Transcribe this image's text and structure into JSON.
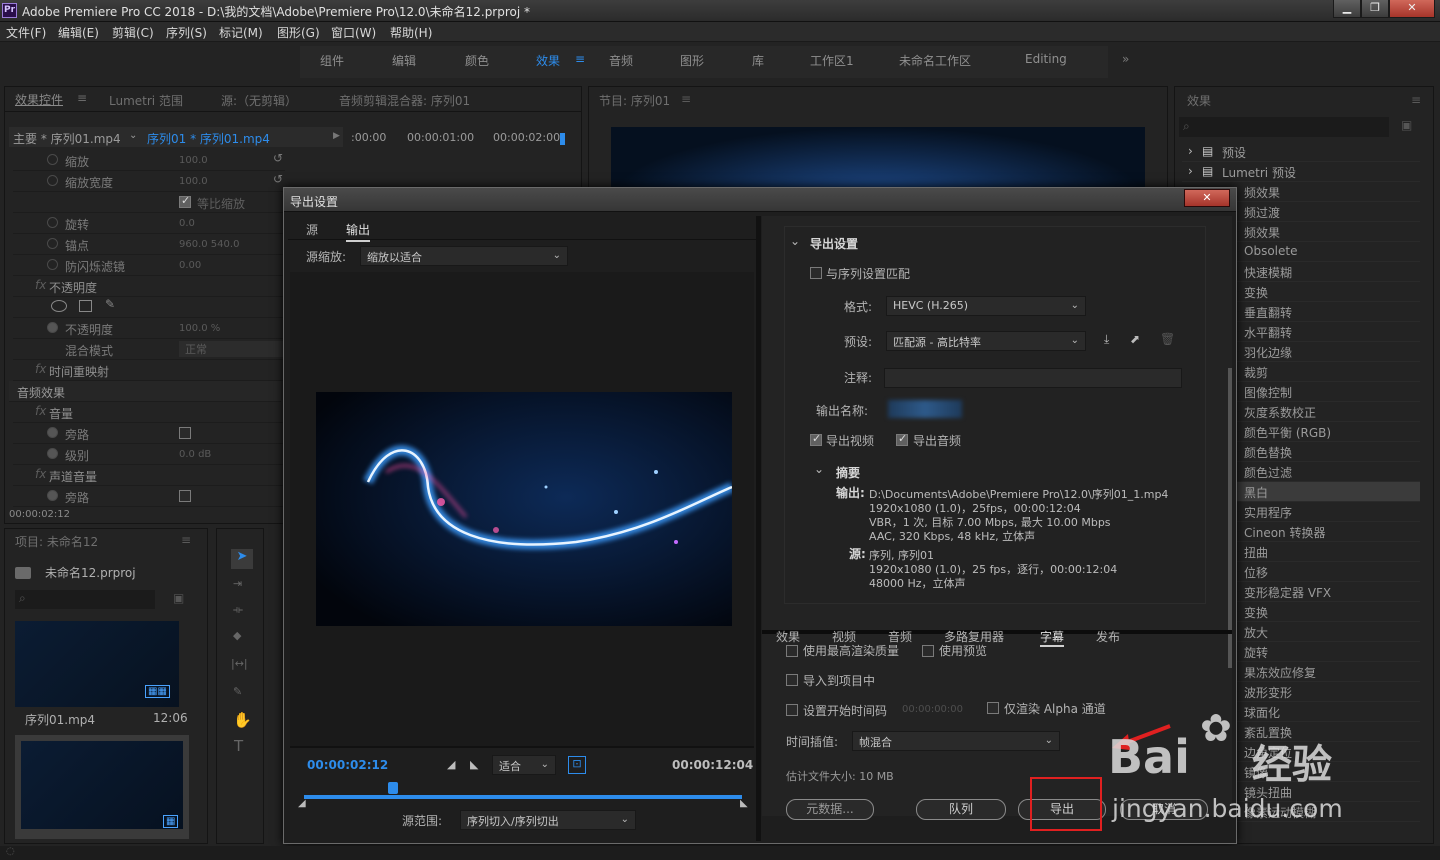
{
  "window": {
    "title": "Adobe Premiere Pro CC 2018 - D:\\我的文档\\Adobe\\Premiere Pro\\12.0\\未命名12.prproj *",
    "app_icon": "Pr"
  },
  "menu": [
    "文件(F)",
    "编辑(E)",
    "剪辑(C)",
    "序列(S)",
    "标记(M)",
    "图形(G)",
    "窗口(W)",
    "帮助(H)"
  ],
  "workspaces": [
    "组件",
    "编辑",
    "颜色",
    "效果",
    "音频",
    "图形",
    "库",
    "工作区1",
    "未命名工作区",
    "Editing"
  ],
  "left_panel": {
    "tabs": [
      "效果控件",
      "Lumetri 范围",
      "源:（无剪辑）",
      "音频剪辑混合器: 序列01"
    ],
    "master": "主要 * 序列01.mp4",
    "clip": "序列01 * 序列01.mp4",
    "ruler": [
      ":00:00",
      "00:00:01:00",
      "00:00:02:00"
    ],
    "rows": [
      {
        "label": "缩放",
        "value": "100.0"
      },
      {
        "label": "缩放宽度",
        "value": "100.0"
      },
      {
        "label": "等比缩放",
        "value": ""
      },
      {
        "label": "旋转",
        "value": "0.0"
      },
      {
        "label": "锚点",
        "value": "960.0    540.0"
      },
      {
        "label": "防闪烁滤镜",
        "value": "0.00"
      },
      {
        "label": "不透明度",
        "value": ""
      },
      {
        "label": "",
        "value": ""
      },
      {
        "label": "不透明度",
        "value": "100.0 %"
      },
      {
        "label": "混合模式",
        "value": "正常"
      },
      {
        "label": "时间重映射",
        "value": ""
      },
      {
        "label": "音频效果",
        "value": ""
      },
      {
        "label": "音量",
        "value": ""
      },
      {
        "label": "旁路",
        "value": ""
      },
      {
        "label": "级别",
        "value": "0.0 dB"
      },
      {
        "label": "声道音量",
        "value": ""
      },
      {
        "label": "旁路",
        "value": ""
      }
    ],
    "timecode": "00:00:02:12"
  },
  "project": {
    "tab": "项目: 未命名12",
    "file": "未命名12.prproj",
    "clip_name": "序列01.mp4",
    "clip_duration": "12:06"
  },
  "program": {
    "tab": "节目: 序列01"
  },
  "effects": {
    "tab": "效果",
    "items": [
      "预设",
      "Lumetri 预设",
      "频效果",
      "频过渡",
      "频效果",
      "Obsolete",
      "快速模糊",
      "变换",
      "垂直翻转",
      "水平翻转",
      "羽化边缘",
      "裁剪",
      "图像控制",
      "灰度系数校正",
      "颜色平衡 (RGB)",
      "颜色替换",
      "颜色过滤",
      "黑白",
      "实用程序",
      "Cineon 转换器",
      "扭曲",
      "位移",
      "变形稳定器 VFX",
      "变换",
      "放大",
      "旋转",
      "果冻效应修复",
      "波形变形",
      "球面化",
      "紊乱置换",
      "边角定位",
      "镜像",
      "镜头扭曲",
      "像素运动模糊"
    ]
  },
  "dialog": {
    "title": "导出设置",
    "left_tabs": [
      "源",
      "输出"
    ],
    "source_scale_label": "源缩放:",
    "source_scale_value": "缩放以适合",
    "current_time": "00:00:02:12",
    "fit": "适合",
    "duration": "00:00:12:04",
    "range_label": "源范围:",
    "range_value": "序列切入/序列切出",
    "export_settings": "导出设置",
    "match_seq": "与序列设置匹配",
    "format_label": "格式:",
    "format_value": "HEVC (H.265)",
    "preset_label": "预设:",
    "preset_value": "匹配源 - 高比特率",
    "comment_label": "注释:",
    "output_name_label": "输出名称:",
    "export_video": "导出视频",
    "export_audio": "导出音频",
    "summary_label": "摘要",
    "output_label": "输出:",
    "output_lines": [
      "D:\\Documents\\Adobe\\Premiere Pro\\12.0\\序列01_1.mp4",
      "1920x1080 (1.0)，25fps，00:00:12:04",
      "VBR，1 次, 目标 7.00 Mbps, 最大 10.00 Mbps",
      "AAC, 320 Kbps, 48 kHz, 立体声"
    ],
    "source_label": "源:",
    "source_lines": [
      "序列, 序列01",
      "1920x1080 (1.0)，25 fps，逐行，00:00:12:04",
      "48000 Hz，立体声"
    ],
    "tabs": [
      "效果",
      "视频",
      "音频",
      "多路复用器",
      "字幕",
      "发布"
    ],
    "max_render": "使用最高渲染质量",
    "use_preview": "使用预览",
    "import_project": "导入到项目中",
    "set_timecode": "设置开始时间码",
    "timecode_value": "00:00:00:00",
    "alpha_only": "仅渲染 Alpha 通道",
    "interp_label": "时间插值:",
    "interp_value": "帧混合",
    "filesize": "估计文件大小:  10 MB",
    "btn_metadata": "元数据...",
    "btn_queue": "队列",
    "btn_export": "导出",
    "btn_cancel": "取消"
  },
  "watermark": {
    "text1": "Bai",
    "text2": "经验",
    "url": "jingyan.baidu.com"
  }
}
